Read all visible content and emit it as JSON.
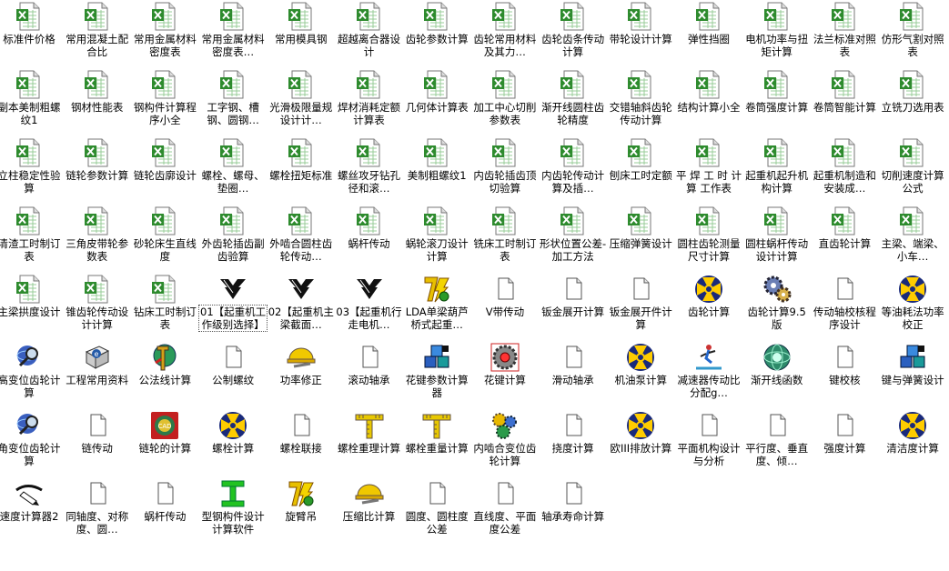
{
  "icon_colors": {
    "excel_green": "#2e8b2e",
    "blank_white": "#ffffff",
    "gear_yellow": "#ffcc00",
    "gear_navy": "#1a2a7a"
  },
  "rows": [
    [
      {
        "label": "标准件价格",
        "icon": "excel-icon"
      },
      {
        "label": "常用混凝土配合比",
        "icon": "excel-icon"
      },
      {
        "label": "常用金属材料密度表",
        "icon": "excel-icon"
      },
      {
        "label": "常用金属材料密度表…",
        "icon": "excel-icon"
      },
      {
        "label": "常用模具钢",
        "icon": "excel-icon"
      },
      {
        "label": "超越离合器设计",
        "icon": "excel-icon"
      },
      {
        "label": "齿轮参数计算",
        "icon": "excel-icon"
      },
      {
        "label": "齿轮常用材料及其力…",
        "icon": "excel-icon"
      },
      {
        "label": "齿轮齿条传动计算",
        "icon": "excel-icon"
      },
      {
        "label": "带轮设计计算",
        "icon": "excel-icon"
      },
      {
        "label": "弹性挡圈",
        "icon": "excel-icon"
      },
      {
        "label": "电机功率与扭矩计算",
        "icon": "excel-icon"
      },
      {
        "label": "法兰标准对照表",
        "icon": "excel-icon"
      },
      {
        "label": "仿形气割对照表",
        "icon": "excel-icon"
      }
    ],
    [
      {
        "label": "副本美制粗螺纹1",
        "icon": "excel-icon"
      },
      {
        "label": "钢材性能表",
        "icon": "excel-icon"
      },
      {
        "label": "钢构件计算程序小全",
        "icon": "excel-icon"
      },
      {
        "label": "工字钢、槽钢、圆钢…",
        "icon": "excel-icon"
      },
      {
        "label": "光滑极限量规设计计…",
        "icon": "excel-icon"
      },
      {
        "label": "焊材消耗定额计算表",
        "icon": "excel-icon"
      },
      {
        "label": "几何体计算表",
        "icon": "excel-icon"
      },
      {
        "label": "加工中心切削参数表",
        "icon": "excel-icon"
      },
      {
        "label": "渐开线圆柱齿轮精度",
        "icon": "excel-icon"
      },
      {
        "label": "交错轴斜齿轮传动计算",
        "icon": "excel-icon"
      },
      {
        "label": "结构计算小全",
        "icon": "excel-icon"
      },
      {
        "label": "卷筒强度计算",
        "icon": "excel-icon"
      },
      {
        "label": "卷筒智能计算",
        "icon": "excel-icon"
      },
      {
        "label": "立铣刀选用表",
        "icon": "excel-icon"
      }
    ],
    [
      {
        "label": "立柱稳定性验算",
        "icon": "excel-icon"
      },
      {
        "label": "链轮参数计算",
        "icon": "excel-icon"
      },
      {
        "label": "链轮齿廓设计",
        "icon": "excel-icon"
      },
      {
        "label": "螺栓、螺母、垫圈…",
        "icon": "excel-icon"
      },
      {
        "label": "螺栓扭矩标准",
        "icon": "excel-icon"
      },
      {
        "label": "螺丝攻牙钻孔径和滚…",
        "icon": "excel-icon"
      },
      {
        "label": "美制粗螺纹1",
        "icon": "excel-icon"
      },
      {
        "label": "内齿轮插齿顶切验算",
        "icon": "excel-icon"
      },
      {
        "label": "内齿轮传动计算及插…",
        "icon": "excel-icon"
      },
      {
        "label": "刨床工时定额",
        "icon": "excel-icon"
      },
      {
        "label": "平 焊 工 时 计 算 工作表",
        "icon": "excel-icon"
      },
      {
        "label": "起重机起升机构计算",
        "icon": "excel-icon"
      },
      {
        "label": "起重机制造和安装成…",
        "icon": "excel-icon"
      },
      {
        "label": "切削速度计算公式",
        "icon": "excel-icon"
      }
    ],
    [
      {
        "label": "清渣工时制订表",
        "icon": "excel-icon"
      },
      {
        "label": "三角皮带轮参数表",
        "icon": "excel-icon"
      },
      {
        "label": "砂轮床生直线度",
        "icon": "excel-icon"
      },
      {
        "label": "外齿轮插齿副齿验算",
        "icon": "excel-icon"
      },
      {
        "label": "外啮合圆柱齿轮传动…",
        "icon": "excel-icon"
      },
      {
        "label": "蜗杆传动",
        "icon": "excel-icon"
      },
      {
        "label": "蜗轮滚刀设计计算",
        "icon": "excel-icon"
      },
      {
        "label": "铣床工时制订表",
        "icon": "excel-icon"
      },
      {
        "label": "形状位置公差-加工方法",
        "icon": "excel-icon"
      },
      {
        "label": "压缩弹簧设计",
        "icon": "excel-icon"
      },
      {
        "label": "圆柱齿轮测量尺寸计算",
        "icon": "excel-icon"
      },
      {
        "label": "圆柱蜗杆传动设计计算",
        "icon": "excel-icon"
      },
      {
        "label": "直齿轮计算",
        "icon": "excel-icon"
      },
      {
        "label": "主梁、端梁、小车…",
        "icon": "excel-icon"
      }
    ],
    [
      {
        "label": "主梁拱度设计",
        "icon": "excel-icon"
      },
      {
        "label": "锥齿轮传动设计计算",
        "icon": "excel-icon"
      },
      {
        "label": "钻床工时制订表",
        "icon": "excel-icon"
      },
      {
        "label": "01【起重机工作级别选择】",
        "icon": "autocad-icon",
        "selected": true
      },
      {
        "label": "02【起重机主梁截面…",
        "icon": "autocad-icon"
      },
      {
        "label": "03【起重机行走电机…",
        "icon": "autocad-icon"
      },
      {
        "label": "LDA单梁葫芦桥式起重…",
        "icon": "lightning-app-icon"
      },
      {
        "label": "V带传动",
        "icon": "blank-file-icon"
      },
      {
        "label": "钣金展开计算",
        "icon": "blank-file-icon"
      },
      {
        "label": "钣金展开件计算",
        "icon": "blank-file-icon"
      },
      {
        "label": "齿轮计算",
        "icon": "yellow-gear-icon"
      },
      {
        "label": "齿轮计算9.5版",
        "icon": "gears-icon"
      },
      {
        "label": "传动轴校核程序设计",
        "icon": "blank-file-icon"
      },
      {
        "label": "等油耗法功率校正",
        "icon": "yellow-gear-icon"
      }
    ],
    [
      {
        "label": "高变位齿轮计算",
        "icon": "magnifier-globe-icon"
      },
      {
        "label": "工程常用资料",
        "icon": "help-book-icon"
      },
      {
        "label": "公法线计算",
        "icon": "caliper-icon"
      },
      {
        "label": "公制螺纹",
        "icon": "blank-file-icon"
      },
      {
        "label": "功率修正",
        "icon": "hardhat-icon"
      },
      {
        "label": "滚动轴承",
        "icon": "blank-file-icon"
      },
      {
        "label": "花键参数计算器",
        "icon": "cube-stack-icon"
      },
      {
        "label": "花键计算",
        "icon": "spline-gear-icon"
      },
      {
        "label": "滑动轴承",
        "icon": "blank-file-icon"
      },
      {
        "label": "机油泵计算",
        "icon": "yellow-gear-icon"
      },
      {
        "label": "减速器传动比分配g…",
        "icon": "skier-icon"
      },
      {
        "label": "渐开线函数",
        "icon": "globe-icon"
      },
      {
        "label": "键校核",
        "icon": "blank-file-icon"
      },
      {
        "label": "键与弹簧设计",
        "icon": "cube-stack-icon"
      }
    ],
    [
      {
        "label": "角变位齿轮计算",
        "icon": "magnifier-globe-icon"
      },
      {
        "label": "链传动",
        "icon": "blank-file-icon"
      },
      {
        "label": "链轮的计算",
        "icon": "chain-sprocket-icon"
      },
      {
        "label": "螺栓计算",
        "icon": "yellow-gear-icon"
      },
      {
        "label": "螺栓联接",
        "icon": "blank-file-icon"
      },
      {
        "label": "螺栓重理计算",
        "icon": "ruler-t-icon"
      },
      {
        "label": "螺栓重量计算",
        "icon": "ruler-t-icon"
      },
      {
        "label": "内啮合变位齿轮计算",
        "icon": "gear-cluster-icon"
      },
      {
        "label": "挠度计算",
        "icon": "blank-file-icon"
      },
      {
        "label": "欧III排放计算",
        "icon": "yellow-gear-icon"
      },
      {
        "label": "平面机构设计与分析",
        "icon": "blank-file-icon"
      },
      {
        "label": "平行度、垂直度、倾…",
        "icon": "blank-file-icon"
      },
      {
        "label": "强度计算",
        "icon": "blank-file-icon"
      },
      {
        "label": "清洁度计算",
        "icon": "yellow-gear-icon"
      }
    ],
    [
      {
        "label": "速度计算器2",
        "icon": "pen-hand-icon"
      },
      {
        "label": "同轴度、对称度、圆…",
        "icon": "blank-file-icon"
      },
      {
        "label": "蜗杆传动",
        "icon": "blank-file-icon"
      },
      {
        "label": "型钢构件设计计算软件",
        "icon": "i-beam-icon"
      },
      {
        "label": "旋臂吊",
        "icon": "lightning-app-icon"
      },
      {
        "label": "压缩比计算",
        "icon": "hardhat-icon"
      },
      {
        "label": "圆度、圆柱度公差",
        "icon": "blank-file-icon"
      },
      {
        "label": "直线度、平面度公差",
        "icon": "blank-file-icon"
      },
      {
        "label": "轴承寿命计算",
        "icon": "blank-file-icon"
      }
    ]
  ]
}
